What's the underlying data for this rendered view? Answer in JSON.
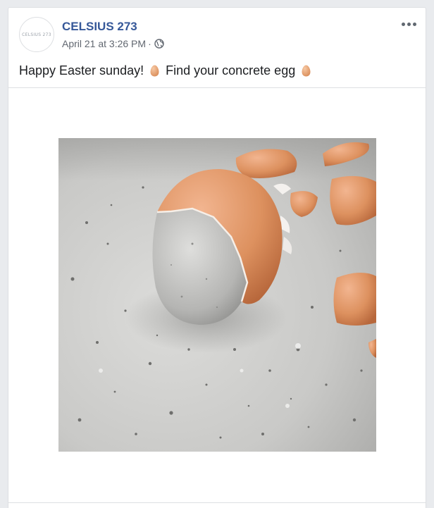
{
  "post": {
    "page_name": "CELSIUS 273",
    "avatar_text": "CELSIUS 273",
    "timestamp": "April 21 at 3:26 PM",
    "separator": "·",
    "audience_icon": "globe-icon",
    "more_icon": "more-options-icon",
    "text_part1": "Happy Easter sunday!",
    "text_part2": "Find your concrete egg",
    "emoji_icon": "egg-emoji-icon"
  },
  "colors": {
    "link": "#365899",
    "meta": "#616770",
    "egg_shell": "#e39a6c",
    "concrete": "#c9c9c7"
  }
}
